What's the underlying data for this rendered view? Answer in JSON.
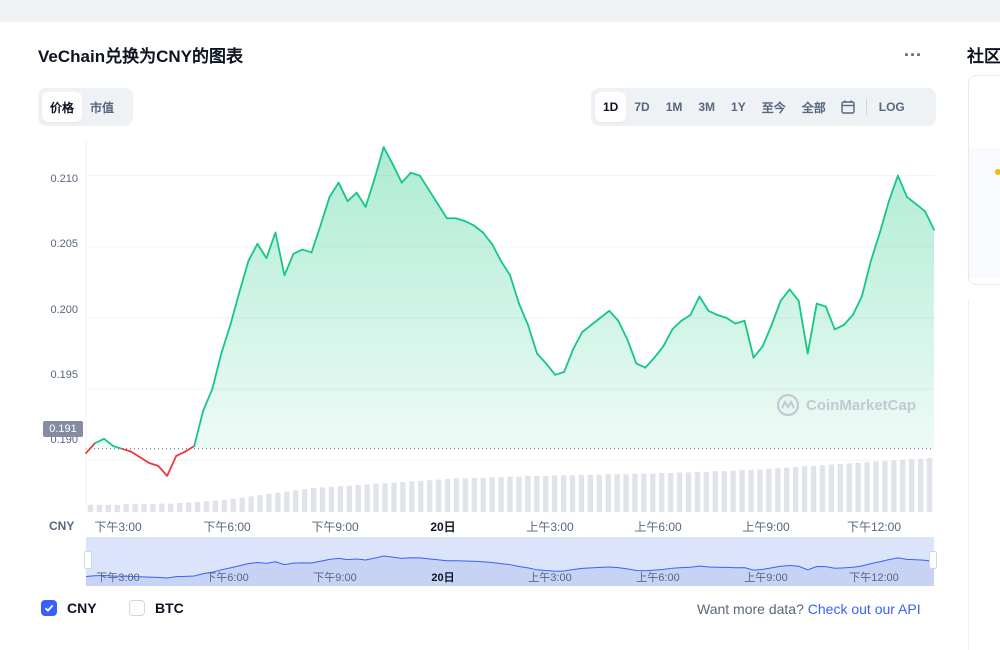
{
  "header": {
    "title": "VeChain兑换为CNY的图表",
    "more_label": "...",
    "side_title": "社区"
  },
  "chart_type_tabs": [
    {
      "label": "价格",
      "active": true
    },
    {
      "label": "市值",
      "active": false
    }
  ],
  "range_tabs": [
    {
      "label": "1D",
      "active": true
    },
    {
      "label": "7D",
      "active": false
    },
    {
      "label": "1M",
      "active": false
    },
    {
      "label": "3M",
      "active": false
    },
    {
      "label": "1Y",
      "active": false
    },
    {
      "label": "至今",
      "active": false
    },
    {
      "label": "全部",
      "active": false
    }
  ],
  "calendar_icon": "calendar-icon",
  "log_label": "LOG",
  "watermark": "CoinMarketCap",
  "current_price_label": "0.191",
  "x_unit": "CNY",
  "legend": [
    {
      "label": "CNY",
      "checked": true
    },
    {
      "label": "BTC",
      "checked": false
    }
  ],
  "api": {
    "prompt": "Want more data?",
    "link": "Check out our API"
  },
  "colors": {
    "up": "#16c784",
    "down": "#ea3943",
    "accent": "#3861fb",
    "navigator": "#dbe4fb"
  },
  "chart_data": {
    "type": "line",
    "y_ticks": [
      "0.210",
      "0.205",
      "0.200",
      "0.195",
      "0.190"
    ],
    "ylim": [
      0.1865,
      0.2125
    ],
    "x_ticks": [
      {
        "label": "下午3:00",
        "bold": false
      },
      {
        "label": "下午6:00",
        "bold": false
      },
      {
        "label": "下午9:00",
        "bold": false
      },
      {
        "label": "20日",
        "bold": true
      },
      {
        "label": "上午3:00",
        "bold": false
      },
      {
        "label": "上午6:00",
        "bold": false
      },
      {
        "label": "上午9:00",
        "bold": false
      },
      {
        "label": "下午12:00",
        "bold": false
      }
    ],
    "reference_price": 0.1908,
    "series": [
      {
        "values": [
          0.1905,
          0.1912,
          0.1915,
          0.191,
          0.1908,
          0.1906,
          0.1902,
          0.1898,
          0.1896,
          0.1889,
          0.1903,
          0.1906,
          0.191,
          0.1935,
          0.195,
          0.1975,
          0.1995,
          0.2018,
          0.204,
          0.2052,
          0.2042,
          0.206,
          0.203,
          0.2045,
          0.2048,
          0.2046,
          0.2065,
          0.2085,
          0.2095,
          0.2082,
          0.2088,
          0.2078,
          0.2098,
          0.212,
          0.2108,
          0.2095,
          0.2102,
          0.21,
          0.209,
          0.208,
          0.207,
          0.207,
          0.2068,
          0.2065,
          0.206,
          0.2052,
          0.204,
          0.203,
          0.201,
          0.1995,
          0.1975,
          0.1968,
          0.196,
          0.1962,
          0.1978,
          0.199,
          0.1995,
          0.2,
          0.2005,
          0.1998,
          0.1985,
          0.1968,
          0.1965,
          0.1972,
          0.198,
          0.1992,
          0.1998,
          0.2002,
          0.2015,
          0.2005,
          0.2002,
          0.2,
          0.1996,
          0.1998,
          0.1972,
          0.198,
          0.1995,
          0.2012,
          0.202,
          0.2012,
          0.1975,
          0.201,
          0.2008,
          0.1992,
          0.1995,
          0.2002,
          0.2015,
          0.204,
          0.206,
          0.2082,
          0.21,
          0.2085,
          0.208,
          0.2075,
          0.2062
        ]
      }
    ],
    "volume": [
      0.12,
      0.12,
      0.12,
      0.12,
      0.13,
      0.13,
      0.13,
      0.13,
      0.14,
      0.14,
      0.15,
      0.16,
      0.17,
      0.18,
      0.19,
      0.2,
      0.22,
      0.24,
      0.26,
      0.28,
      0.3,
      0.32,
      0.34,
      0.36,
      0.38,
      0.4,
      0.41,
      0.42,
      0.43,
      0.44,
      0.45,
      0.46,
      0.47,
      0.48,
      0.49,
      0.5,
      0.51,
      0.52,
      0.53,
      0.54,
      0.55,
      0.56,
      0.56,
      0.57,
      0.57,
      0.58,
      0.58,
      0.59,
      0.59,
      0.6,
      0.6,
      0.6,
      0.61,
      0.61,
      0.61,
      0.62,
      0.62,
      0.62,
      0.63,
      0.63,
      0.63,
      0.64,
      0.64,
      0.64,
      0.65,
      0.65,
      0.66,
      0.66,
      0.67,
      0.67,
      0.68,
      0.68,
      0.69,
      0.7,
      0.7,
      0.71,
      0.72,
      0.73,
      0.74,
      0.75,
      0.76,
      0.77,
      0.78,
      0.79,
      0.8,
      0.81,
      0.82,
      0.83,
      0.84,
      0.85,
      0.86,
      0.87,
      0.88,
      0.89,
      0.9
    ],
    "navigator_ticks": [
      {
        "label": "下午3:00",
        "bold": false
      },
      {
        "label": "下午6:00",
        "bold": false
      },
      {
        "label": "下午9:00",
        "bold": false
      },
      {
        "label": "20日",
        "bold": true
      },
      {
        "label": "上午3:00",
        "bold": false
      },
      {
        "label": "上午6:00",
        "bold": false
      },
      {
        "label": "上午9:00",
        "bold": false
      },
      {
        "label": "下午12:00",
        "bold": false
      }
    ],
    "grid": true
  }
}
